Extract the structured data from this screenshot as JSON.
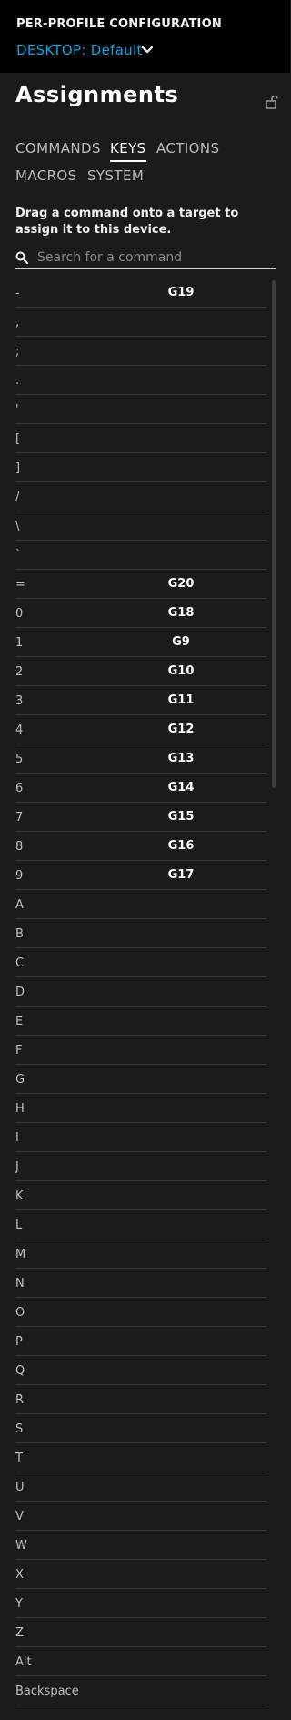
{
  "topbar": {
    "title": "PER-PROFILE CONFIGURATION",
    "profile_prefix": "DESKTOP:",
    "profile_name": "Default"
  },
  "header": {
    "title": "Assignments"
  },
  "tabs": [
    {
      "label": "COMMANDS",
      "active": false
    },
    {
      "label": "KEYS",
      "active": true
    },
    {
      "label": "ACTIONS",
      "active": false
    },
    {
      "label": "MACROS",
      "active": false
    },
    {
      "label": "SYSTEM",
      "active": false
    }
  ],
  "description": "Drag a command onto a target to assign it to this device.",
  "search": {
    "placeholder": "Search for a command"
  },
  "keys": [
    {
      "key": "-",
      "assigned": "G19"
    },
    {
      "key": ",",
      "assigned": ""
    },
    {
      "key": ";",
      "assigned": ""
    },
    {
      "key": ".",
      "assigned": ""
    },
    {
      "key": "'",
      "assigned": ""
    },
    {
      "key": "[",
      "assigned": ""
    },
    {
      "key": "]",
      "assigned": ""
    },
    {
      "key": "/",
      "assigned": ""
    },
    {
      "key": "\\",
      "assigned": ""
    },
    {
      "key": "`",
      "assigned": ""
    },
    {
      "key": "=",
      "assigned": "G20"
    },
    {
      "key": "0",
      "assigned": "G18"
    },
    {
      "key": "1",
      "assigned": "G9"
    },
    {
      "key": "2",
      "assigned": "G10"
    },
    {
      "key": "3",
      "assigned": "G11"
    },
    {
      "key": "4",
      "assigned": "G12"
    },
    {
      "key": "5",
      "assigned": "G13"
    },
    {
      "key": "6",
      "assigned": "G14"
    },
    {
      "key": "7",
      "assigned": "G15"
    },
    {
      "key": "8",
      "assigned": "G16"
    },
    {
      "key": "9",
      "assigned": "G17"
    },
    {
      "key": "A",
      "assigned": ""
    },
    {
      "key": "B",
      "assigned": ""
    },
    {
      "key": "C",
      "assigned": ""
    },
    {
      "key": "D",
      "assigned": ""
    },
    {
      "key": "E",
      "assigned": ""
    },
    {
      "key": "F",
      "assigned": ""
    },
    {
      "key": "G",
      "assigned": ""
    },
    {
      "key": "H",
      "assigned": ""
    },
    {
      "key": "I",
      "assigned": ""
    },
    {
      "key": "J",
      "assigned": ""
    },
    {
      "key": "K",
      "assigned": ""
    },
    {
      "key": "L",
      "assigned": ""
    },
    {
      "key": "M",
      "assigned": ""
    },
    {
      "key": "N",
      "assigned": ""
    },
    {
      "key": "O",
      "assigned": ""
    },
    {
      "key": "P",
      "assigned": ""
    },
    {
      "key": "Q",
      "assigned": ""
    },
    {
      "key": "R",
      "assigned": ""
    },
    {
      "key": "S",
      "assigned": ""
    },
    {
      "key": "T",
      "assigned": ""
    },
    {
      "key": "U",
      "assigned": ""
    },
    {
      "key": "V",
      "assigned": ""
    },
    {
      "key": "W",
      "assigned": ""
    },
    {
      "key": "X",
      "assigned": ""
    },
    {
      "key": "Y",
      "assigned": ""
    },
    {
      "key": "Z",
      "assigned": ""
    },
    {
      "key": "Alt",
      "assigned": ""
    },
    {
      "key": "Backspace",
      "assigned": ""
    }
  ],
  "icons": {
    "profile_dropdown": "chevron-down-icon",
    "lock": "unlock-icon",
    "search": "search-icon"
  },
  "colors": {
    "accent": "#00a8e0",
    "background": "#1b1b1b",
    "topbar": "#000000"
  }
}
